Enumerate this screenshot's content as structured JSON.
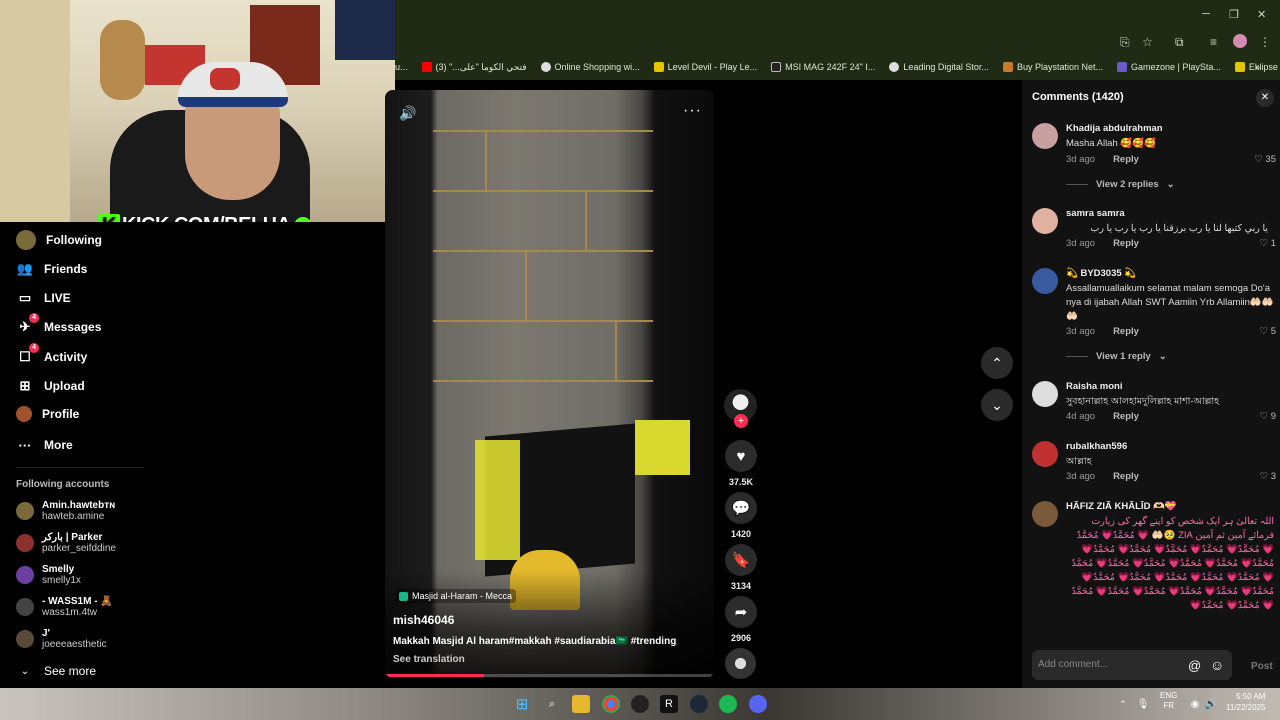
{
  "browser": {
    "bookmarks": [
      {
        "label": "u...",
        "color": "#999999"
      },
      {
        "label": "فتحي الكوما \"على...\" (3)",
        "color": "#ff0000"
      },
      {
        "label": "Online Shopping wi...",
        "color": "#dddddd"
      },
      {
        "label": "Level Devil - Play Le...",
        "color": "#e6c300"
      },
      {
        "label": "MSI MAG 242F 24\" I...",
        "color": "#222222"
      },
      {
        "label": "Leading Digital Stor...",
        "color": "#dddddd"
      },
      {
        "label": "Buy Playstation Net...",
        "color": "#c77b2b"
      },
      {
        "label": "Gamezone | PlaySta...",
        "color": "#6a5acd"
      },
      {
        "label": "Eklipse - Convert Tw...",
        "color": "#e6c300"
      }
    ]
  },
  "overlay": {
    "kick_text": "KICK.COM/BELHA",
    "kick_letter": "K"
  },
  "nav": {
    "items": [
      {
        "label": "Following"
      },
      {
        "label": "Friends"
      },
      {
        "label": "LIVE"
      },
      {
        "label": "Messages",
        "badge": "4"
      },
      {
        "label": "Activity",
        "badge": "4"
      },
      {
        "label": "Upload"
      },
      {
        "label": "Profile"
      },
      {
        "label": "More"
      }
    ],
    "following_title": "Following accounts",
    "accounts": [
      {
        "name": "Amin.hawtebᴛɴ",
        "handle": "hawteb.amine",
        "color": "#7a6a3a"
      },
      {
        "name": "باركر | Parker",
        "handle": "parker_seifddine",
        "color": "#8b2f2f"
      },
      {
        "name": "Smelly",
        "handle": "smelly1x",
        "color": "#6b3fa0"
      },
      {
        "name": "- WASS1M - 🧸",
        "handle": "wass1m.4tw",
        "color": "#444444"
      },
      {
        "name": "J'",
        "handle": "joeeeaesthetic",
        "color": "#5a4a3a"
      }
    ],
    "see_more": "See more"
  },
  "video": {
    "location": "Masjid al-Haram - Mecca",
    "author": "mish46046",
    "caption": "Makkah Masjid Al haram#makkah #saudiarabia🇸🇦 #trending",
    "see_translation": "See translation",
    "progress": 0.3,
    "likes": "37.5K",
    "comments": "1420",
    "saves": "3134",
    "shares": "2906"
  },
  "comments_panel": {
    "title": "Comments (1420)",
    "reply_label": "Reply",
    "items": [
      {
        "name": "Khadija abdulrahman",
        "text": "Masha Allah 🥰🥰🥰",
        "time": "3d ago",
        "likes": "35",
        "replies": "View 2 replies",
        "color": "#c9a0a0"
      },
      {
        "name": "samra samra",
        "text": "يا ربي كتبها لنا يا رب برزقنا يا رب يا رب يا رب",
        "time": "3d ago",
        "likes": "1",
        "replies": "",
        "color": "#e0b0a0"
      },
      {
        "name": "💫 BYD3035 💫",
        "text": "Assallamuallaikum selamat malam semoga Do'a nya di ijabah Allah SWT Aamiin Yrb Allamiin🤲🏻🤲🏻🤲🏻",
        "time": "3d ago",
        "likes": "5",
        "replies": "View 1 reply",
        "color": "#3a5aa0"
      },
      {
        "name": "Raisha moni",
        "text": "সুবহানাল্লাহ আলহামদুলিল্লাহ মাশা-আল্লাহ",
        "time": "4d ago",
        "likes": "9",
        "replies": "",
        "color": "#dddddd"
      },
      {
        "name": "rubalkhan596",
        "text": "আল্লাহ",
        "time": "3d ago",
        "likes": "3",
        "replies": "",
        "color": "#c03030"
      },
      {
        "name": "HÃFIZ ZIÃ KHÃLĪD 🫶🏻💝",
        "text": "اللہ تعالیٰ ہر ایک شخص کو اپنے گھر کی زیارت فرمائے آمین ثم آمین ZIA 🥺🤲🏻 💗 مُحَمَّدٌ💗 مُحَمَّدٌ💗 مُحَمَّدٌ💗 مُحَمَّدٌ💗 مُحَمَّدٌ💗 مُحَمَّدٌ💗 مُحَمَّدٌ💗 مُحَمَّدٌ💗 مُحَمَّدٌ💗 مُحَمَّدٌ💗 مُحَمَّدٌ💗 مُحَمَّدٌ💗 مُحَمَّدٌ💗 مُحَمَّدٌ💗 مُحَمَّدٌ💗 مُحَمَّدٌ💗 مُحَمَّدٌ💗 مُحَمَّدٌ💗 مُحَمَّدٌ💗 مُحَمَّدٌ💗 مُحَمَّدٌ💗 مُحَمَّدٌ💗 مُحَمَّدٌ💗 مُحَمَّدٌ💗 مُحَمَّدٌ💗 مُحَمَّدٌ💗",
        "time": "",
        "likes": "",
        "replies": "",
        "color": "#7a5a3a"
      }
    ],
    "add_placeholder": "Add comment...",
    "post_label": "Post"
  },
  "taskbar": {
    "lang1": "ENG",
    "lang2": "FR",
    "time": "5:50 AM",
    "date": "11/22/2025"
  }
}
